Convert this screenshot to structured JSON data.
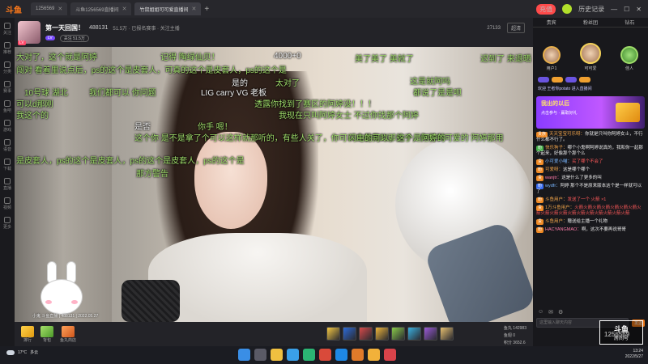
{
  "browser": {
    "brand": "斗鱼",
    "tabs": [
      {
        "label": "1256569",
        "active": false
      },
      {
        "label": "斗鱼1256569直播间",
        "active": false
      },
      {
        "label": "竹鼠姐姐可可爱直播间",
        "active": true
      }
    ],
    "recharge_label": "充值",
    "right_label": "历史记录"
  },
  "leftnav": [
    {
      "label": "关注"
    },
    {
      "label": "推荐"
    },
    {
      "label": "分类"
    },
    {
      "label": "赛事"
    },
    {
      "label": "鱼吧"
    },
    {
      "label": "游戏"
    },
    {
      "label": "语音"
    },
    {
      "label": "下载"
    },
    {
      "label": "直播"
    },
    {
      "label": "视频"
    },
    {
      "label": "更多"
    }
  ],
  "room": {
    "title": "第一天回国！",
    "room_id": "488131",
    "meta": "51.5万 · 已报名赛事 · 关注主播",
    "badge": "LV",
    "sub_label": "关注 51.5万",
    "right_meta": "27133",
    "quality": "超清"
  },
  "video": {
    "danmu": [
      {
        "text": "大对了，这个就是阿婷",
        "color": "g"
      },
      {
        "text": "记得 陶绿仙贝！",
        "color": "g"
      },
      {
        "text": "4000+0",
        "color": "w"
      },
      {
        "text": "美了美了 美就了",
        "color": "g"
      },
      {
        "text": "迟到了 来退晒",
        "color": "g"
      },
      {
        "text": "闯对 看着里说点后，ps的这个是皮套人，可真的这个是皮套人，ps的这个是",
        "color": "g"
      },
      {
        "text": "是的",
        "color": "w"
      },
      {
        "text": "太对了",
        "color": "g"
      },
      {
        "text": "这是就阿吗",
        "color": "g"
      },
      {
        "text": "10号球 湖北",
        "color": "g"
      },
      {
        "text": "我们都可以 你问题",
        "color": "g"
      },
      {
        "text": "LIG carry VG 老板",
        "color": "w"
      },
      {
        "text": "都说了是是呗",
        "color": "g"
      },
      {
        "text": "可以d那刚",
        "color": "g"
      },
      {
        "text": "透露你找到了赛区的阿婷没！！！",
        "color": "g"
      },
      {
        "text": "我这个的",
        "color": "g"
      },
      {
        "text": "我现在只叫阿婷女士 不过你找那个阿婷",
        "color": "g"
      },
      {
        "text": "是否",
        "color": "w"
      },
      {
        "text": "你手 嗯！",
        "color": "g"
      },
      {
        "text": "这个你 是不是拿了个可以这样就那听的，有些人关了，你可以去看我的那些子，你看到可爱的 阿婷那用",
        "color": "g"
      },
      {
        "text": "闪电的可以，这个是阿婷的",
        "color": "g"
      },
      {
        "text": "是皮套人，ps的这个是皮套人，ps的这个是皮套人，ps的这个是",
        "color": "g"
      },
      {
        "text": "那方警告",
        "color": "g"
      }
    ],
    "footer": "小鬼 斗鱼直播 | 488131 | 2022.05.27"
  },
  "gifts": {
    "left": [
      {
        "label": "排行"
      },
      {
        "label": "背包"
      },
      {
        "label": "鱼丸商店"
      }
    ],
    "row_count": 8,
    "stats": [
      "鱼丸 142983",
      "鱼翅 0",
      "积分 3652.6"
    ]
  },
  "rpanel": {
    "tabs": [
      "贵宾",
      "粉丝团",
      "钻石"
    ],
    "rank": [
      {
        "name": "用户1",
        "pos": "2"
      },
      {
        "name": "可可爱",
        "pos": "1"
      },
      {
        "name": "佳人",
        "pos": "3"
      }
    ],
    "system_msg": "欢迎 王者你potato 进入直播间",
    "promo": {
      "title": "我出的以后",
      "subtitle": "点击参与 · 赢取好礼"
    },
    "messages": [
      {
        "tag": "贵族",
        "tag_color": "o",
        "name": "天天宝宝可乐呀：",
        "name_color": "orange",
        "text": "你就是只叫你阿婷女士，不行什么都不行了。",
        "text_color": ""
      },
      {
        "tag": "粉",
        "tag_color": "g",
        "name": "快乐狗子：",
        "name_color": "orange",
        "text": "哪个小鬼啊阿婷说真的，我和你一起那个起来，好像那个那个么",
        "text_color": ""
      },
      {
        "tag": "贵",
        "tag_color": "o",
        "name": "小可爱小喵：",
        "name_color": "blue",
        "text": "买了哪个不会了",
        "text_color": "red"
      },
      {
        "tag": "粉",
        "tag_color": "o",
        "name": "可爱呀：",
        "name_color": "orange",
        "text": "这是哪个哪个",
        "text_color": ""
      },
      {
        "tag": "贵",
        "tag_color": "o",
        "name": "wanjtr：",
        "name_color": "pink",
        "text": "这是什么了更多的叫",
        "text_color": ""
      },
      {
        "tag": "粉",
        "tag_color": "b",
        "name": "wydfr：",
        "name_color": "blue",
        "text": "阿婷 那个不是原来版本这个是一样就可以了",
        "text_color": ""
      },
      {
        "tag": "粉",
        "tag_color": "o",
        "name": "斗鱼用户：",
        "name_color": "orange",
        "text": "发送了一个 火箭 ×1",
        "text_color": "red"
      },
      {
        "tag": "贵",
        "tag_color": "o",
        "name": "1万斗鱼用户：",
        "name_color": "orange",
        "text": "火箭火箭火箭火箭火箭火箭火箭火箭火箭火箭火箭火箭火箭火箭火箭火箭火箭火箭",
        "text_color": "red"
      },
      {
        "tag": "贵",
        "tag_color": "o",
        "name": "斗鱼用户：",
        "name_color": "orange",
        "text": "赠送给主播一个礼物",
        "text_color": ""
      },
      {
        "tag": "粉",
        "tag_color": "o",
        "name": "HACYANGMAO：",
        "name_color": "pink",
        "text": "啊，这次不要再说哥哥",
        "text_color": ""
      }
    ],
    "input_placeholder": "这里输入聊天内容",
    "send_label": "发送",
    "watermark": "斗鱼",
    "watermark_id": "房间号",
    "viewer_count": "1256569"
  },
  "taskbar": {
    "weather_temp": "17°C",
    "weather_desc": "多云",
    "time": "13:24",
    "date": "2022/5/27"
  }
}
